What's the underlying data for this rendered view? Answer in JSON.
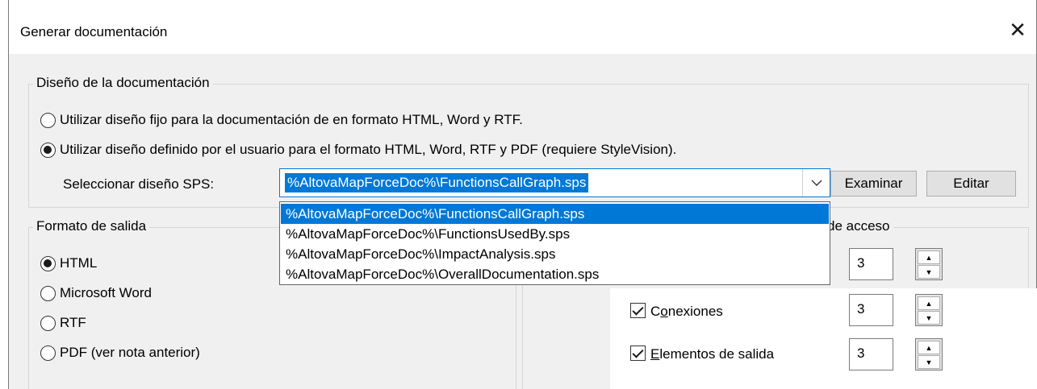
{
  "window": {
    "title": "Generar documentación",
    "close_glyph": "✕"
  },
  "design_group": {
    "legend": "Diseño de la documentación",
    "options": [
      {
        "label": "Utilizar diseño fijo para la documentación de en formato HTML, Word y RTF.",
        "selected": false
      },
      {
        "label": "Utilizar diseño definido por el usuario para el formato HTML, Word, RTF y PDF (requiere StyleVision).",
        "selected": true
      }
    ],
    "sps_label": "Seleccionar diseño SPS:",
    "sps_value": "%AltovaMapForceDoc%\\FunctionsCallGraph.sps",
    "browse_button": "Examinar",
    "edit_button": "Editar",
    "dropdown_items": [
      {
        "label": "%AltovaMapForceDoc%\\FunctionsCallGraph.sps",
        "selected": true
      },
      {
        "label": "%AltovaMapForceDoc%\\FunctionsUsedBy.sps",
        "selected": false
      },
      {
        "label": "%AltovaMapForceDoc%\\ImpactAnalysis.sps",
        "selected": false
      },
      {
        "label": "%AltovaMapForceDoc%\\OverallDocumentation.sps",
        "selected": false
      }
    ]
  },
  "output_group": {
    "legend": "Formato de salida",
    "options": [
      {
        "label": "HTML",
        "selected": true
      },
      {
        "label": "Microsoft Word",
        "selected": false
      },
      {
        "label": "RTF",
        "selected": false
      },
      {
        "label": "PDF (ver nota anterior)",
        "selected": false
      }
    ]
  },
  "access_group": {
    "legend_partial": "de acceso",
    "rows": [
      {
        "label": "",
        "checked": null,
        "value": "3"
      },
      {
        "label": "Conexiones",
        "mnemonic_index": 1,
        "checked": true,
        "value": "3"
      },
      {
        "label": "Elementos de salida",
        "mnemonic_index": 0,
        "checked": true,
        "value": "3"
      }
    ]
  },
  "icons": {
    "radio": "radio-button",
    "checkbox": "checkbox",
    "chevron": "chevron-down-icon",
    "spin_up": "▲",
    "spin_down": "▼"
  }
}
